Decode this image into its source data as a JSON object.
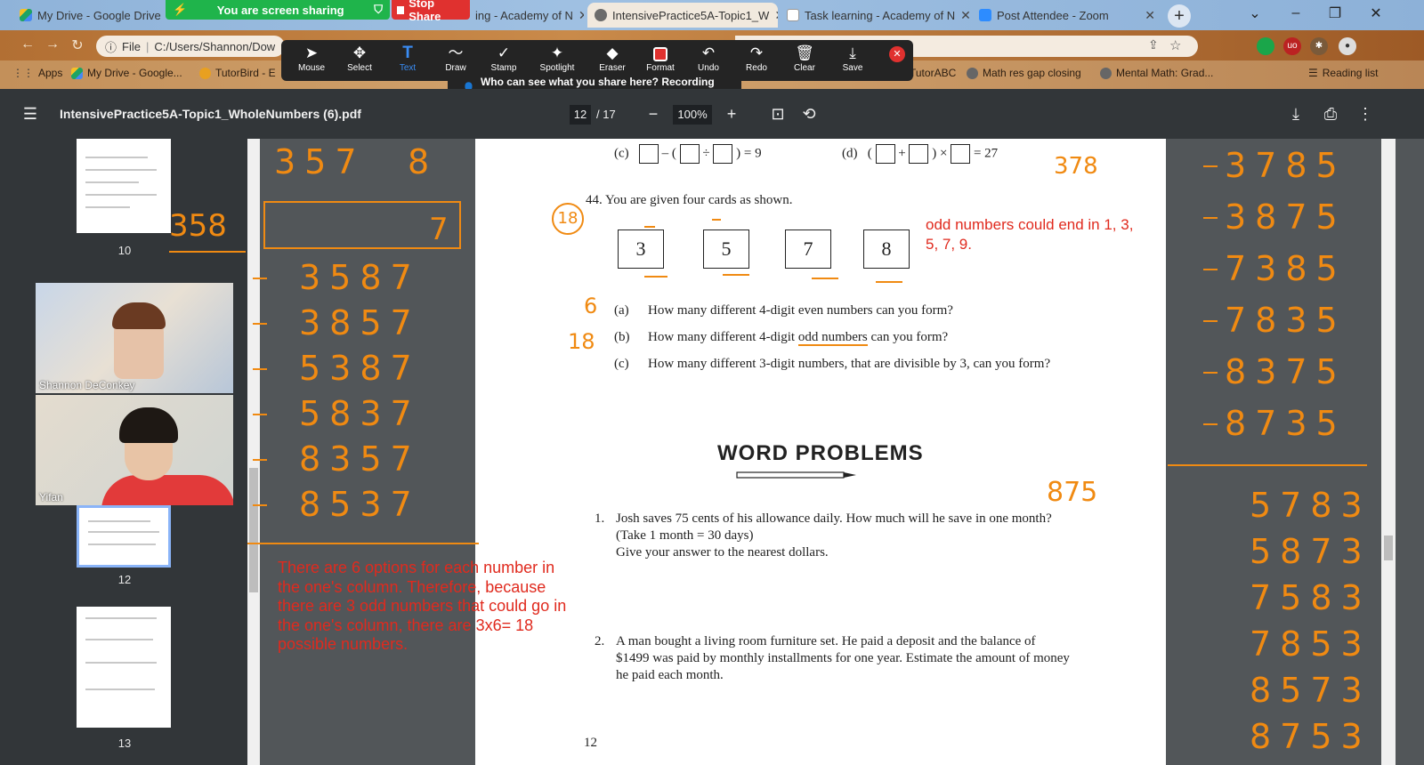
{
  "tabs": [
    {
      "title": "My Drive - Google Drive",
      "active": false
    },
    {
      "title": "ing - Academy of N",
      "active": false
    },
    {
      "title": "IntensivePractice5A-Topic1_W",
      "active": true
    },
    {
      "title": "Task learning - Academy of N",
      "active": false
    },
    {
      "title": "Post Attendee - Zoom",
      "active": false
    }
  ],
  "share": {
    "status": "You are screen sharing",
    "stop_label": "Stop Share",
    "notice": "Who can see what you share here? Recording On"
  },
  "annotation_tools": [
    {
      "label": "Mouse",
      "icon": "arrow-cursor-icon"
    },
    {
      "label": "Select",
      "icon": "move-icon"
    },
    {
      "label": "Text",
      "icon": "text-icon"
    },
    {
      "label": "Draw",
      "icon": "draw-icon"
    },
    {
      "label": "Stamp",
      "icon": "check-icon"
    },
    {
      "label": "Spotlight",
      "icon": "spotlight-icon"
    },
    {
      "label": "Eraser",
      "icon": "eraser-icon"
    },
    {
      "label": "Format",
      "icon": "format-icon"
    },
    {
      "label": "Undo",
      "icon": "undo-icon"
    },
    {
      "label": "Redo",
      "icon": "redo-icon"
    },
    {
      "label": "Clear",
      "icon": "trash-icon"
    },
    {
      "label": "Save",
      "icon": "save-icon"
    }
  ],
  "address": {
    "prefix": "File",
    "url": "C:/Users/Shannon/Dow"
  },
  "bookmarks": [
    {
      "label": "Apps"
    },
    {
      "label": "My Drive - Google..."
    },
    {
      "label": "TutorBird - E"
    },
    {
      "label": "TutorABC"
    },
    {
      "label": "Math res gap closing"
    },
    {
      "label": "Mental Math: Grad..."
    },
    {
      "label": "Reading list"
    }
  ],
  "pdf": {
    "title": "IntensivePractice5A-Topic1_WholeNumbers (6).pdf",
    "page": "12",
    "total": "/ 17",
    "zoom": "100%"
  },
  "thumbnails": [
    {
      "num": "10"
    },
    {
      "num": "12"
    },
    {
      "num": "13"
    }
  ],
  "video": [
    {
      "name": "Shannon DeConkey"
    },
    {
      "name": "Yifan"
    }
  ],
  "page_content": {
    "row_c_label": "(c)",
    "row_c_eq": "= 9",
    "row_d_label": "(d)",
    "row_d_eq": "= 27",
    "q44": "44.  You are given four cards as shown.",
    "cards": [
      "3",
      "5",
      "7",
      "8"
    ],
    "a_label": "(a)",
    "a_text": "How many different 4-digit even numbers can you form?",
    "b_label": "(b)",
    "b_pre": "How many different 4-digit ",
    "b_und": "odd numbers",
    "b_post": " can you form?",
    "c_label": "(c)",
    "c_text": "How many different 3-digit numbers, that are divisible by 3, can you form?",
    "wp_title": "WORD PROBLEMS",
    "p1_num": "1.",
    "p1_text": "Josh saves 75 cents of his allowance daily. How much will he save in one month? (Take 1 month = 30 days)",
    "p1_text2": "Give your answer to the nearest dollars.",
    "p2_num": "2.",
    "p2_text": "A man bought a living room furniture set. He paid a deposit and the balance of $1499 was paid by monthly installments for one year. Estimate the amount of money he paid each month.",
    "page_number": "12"
  },
  "annotations": {
    "note_odd": "odd numbers could end in 1, 3, 5, 7, 9.",
    "note_options": "There are 6 options for each number in the one's column.  Therefore, because there are 3 odd numbers that could go in the one's column, there are 3x6= 18 possible numbers.",
    "circle_18": "18",
    "label_6": "6",
    "label_18": "18",
    "top_378": "378",
    "label_875": "875",
    "top_left_357": "357",
    "top_left_8": "8",
    "left_358": "358",
    "box_7": "7",
    "left_list": [
      "3587",
      "3857",
      "5387",
      "5837",
      "8357",
      "8537"
    ],
    "right_list_5": [
      "3785",
      "3875",
      "7385",
      "7835",
      "8375",
      "8735"
    ],
    "right_list_3": [
      "5783",
      "5873",
      "7583",
      "7853",
      "8573",
      "8753"
    ]
  },
  "colors": {
    "ink_orange": "#f08a12",
    "ink_red": "#e02a1e",
    "share_green": "#1fb44b",
    "stop_red": "#e0312f",
    "pdf_bar": "#323639"
  }
}
